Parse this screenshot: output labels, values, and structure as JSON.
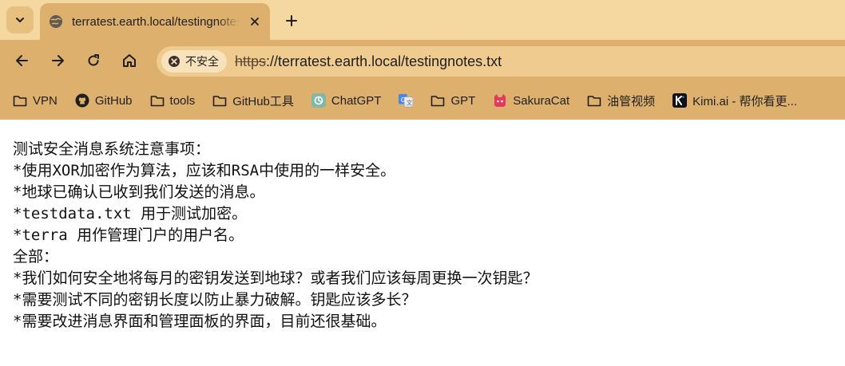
{
  "tab": {
    "title": "terratest.earth.local/testingnotes.txt"
  },
  "toolbar": {
    "security_label": "不安全",
    "url_scheme": "https",
    "url_rest": "://terratest.earth.local/testingnotes.txt"
  },
  "bookmarks": [
    {
      "label": "VPN",
      "icon": "folder-icon"
    },
    {
      "label": "GitHub",
      "icon": "github-icon"
    },
    {
      "label": "tools",
      "icon": "folder-icon"
    },
    {
      "label": "GitHub工具",
      "icon": "folder-icon"
    },
    {
      "label": "ChatGPT",
      "icon": "chatgpt-icon"
    },
    {
      "label": "",
      "icon": "google-translate-icon"
    },
    {
      "label": "GPT",
      "icon": "folder-icon"
    },
    {
      "label": "SakuraCat",
      "icon": "cat-icon"
    },
    {
      "label": "油管视频",
      "icon": "folder-icon"
    },
    {
      "label": "Kimi.ai - 帮你看更...",
      "icon": "kimi-icon"
    }
  ],
  "document": {
    "lines": [
      "测试安全消息系统注意事项：",
      "*使用XOR加密作为算法，应该和RSA中使用的一样安全。",
      "*地球已确认已收到我们发送的消息。",
      "*testdata.txt 用于测试加密。",
      "*terra 用作管理门户的用户名。",
      "全部：",
      "*我们如何安全地将每月的密钥发送到地球？或者我们应该每周更换一次钥匙？",
      "*需要测试不同的密钥长度以防止暴力破解。钥匙应该多长？",
      "*需要改进消息界面和管理面板的界面，目前还很基础。"
    ]
  }
}
